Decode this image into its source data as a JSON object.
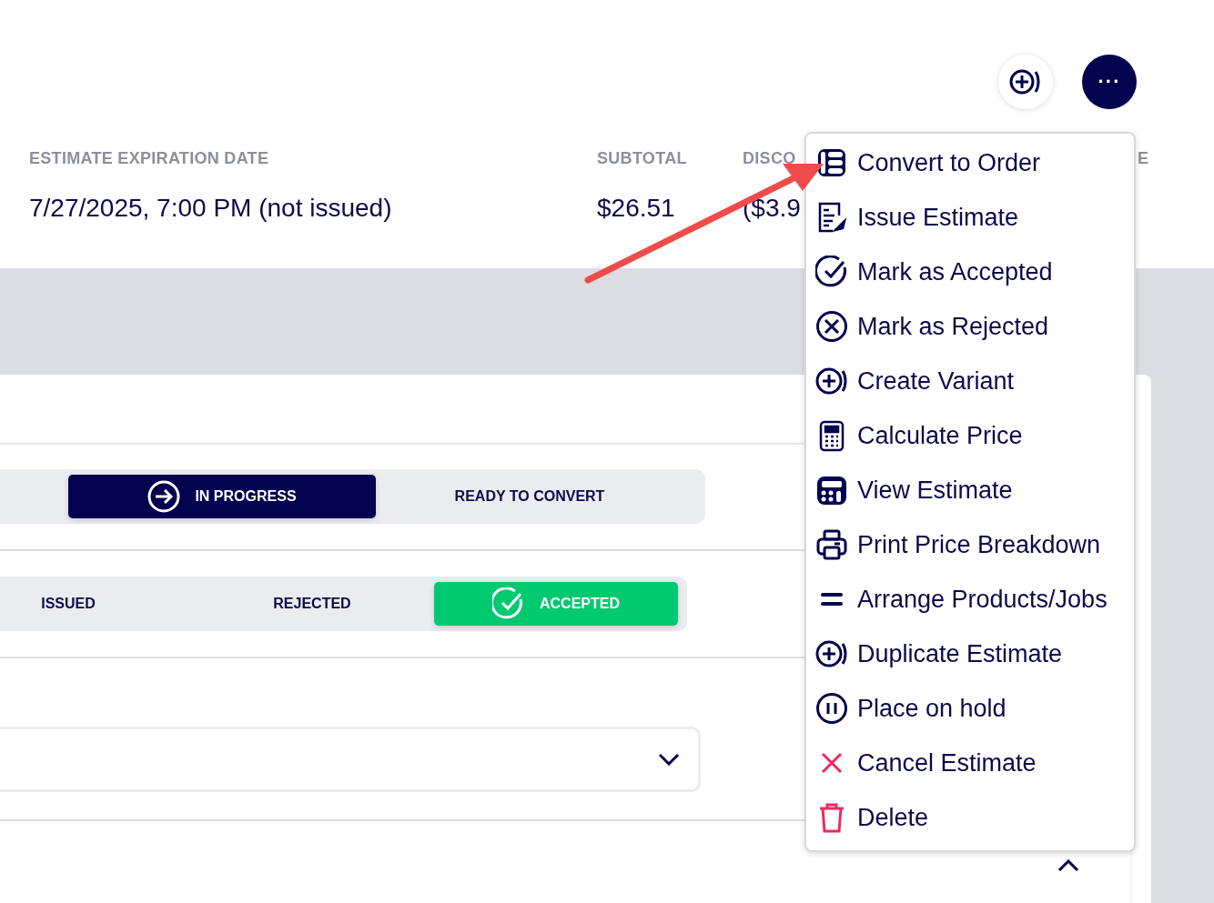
{
  "toolbar": {
    "buttons": [
      {
        "kind": "add"
      },
      {
        "kind": "more",
        "label": "···"
      }
    ]
  },
  "summary": {
    "columns": [
      {
        "heading": "ESTIMATE EXPIRATION DATE",
        "value": "7/27/2025, 7:00 PM (not issued)"
      },
      {
        "heading": "SUBTOTAL",
        "value": "$26.51"
      },
      {
        "heading": "DISCO",
        "value": "($3.9"
      },
      {
        "heading": "E"
      }
    ]
  },
  "status_groups": [
    {
      "kind": "progress",
      "options": [
        {
          "label": "IN PROGRESS",
          "selected": true
        },
        {
          "label": "READY TO CONVERT",
          "selected": false
        }
      ]
    },
    {
      "kind": "response",
      "options": [
        {
          "label": "ISSUED",
          "selected": false
        },
        {
          "label": "REJECTED",
          "selected": false
        },
        {
          "label": "ACCEPTED",
          "selected": true
        }
      ]
    }
  ],
  "actions_menu": {
    "items": [
      {
        "label": "Convert to Order",
        "kind": "normal"
      },
      {
        "label": "Issue Estimate",
        "kind": "normal"
      },
      {
        "label": "Mark as Accepted",
        "kind": "normal"
      },
      {
        "label": "Mark as Rejected",
        "kind": "normal"
      },
      {
        "label": "Create Variant",
        "kind": "normal"
      },
      {
        "label": "Calculate Price",
        "kind": "normal"
      },
      {
        "label": "View Estimate",
        "kind": "normal"
      },
      {
        "label": "Print Price Breakdown",
        "kind": "normal"
      },
      {
        "label": "Arrange Products/Jobs",
        "kind": "normal"
      },
      {
        "label": "Duplicate Estimate",
        "kind": "normal"
      },
      {
        "label": "Place on hold",
        "kind": "normal"
      },
      {
        "label": "Cancel Estimate",
        "kind": "danger"
      },
      {
        "label": "Delete",
        "kind": "danger"
      }
    ]
  }
}
